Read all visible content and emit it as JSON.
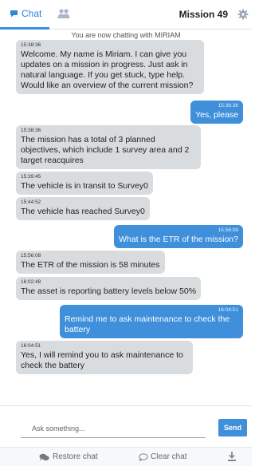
{
  "header": {
    "chat_tab_label": "Chat",
    "chat_icon": "chat-bubble-icon",
    "people_icon": "people-icon",
    "mission_title": "Mission 49",
    "settings_icon": "gear-icon"
  },
  "chat": {
    "notice": "You are now chatting with MIRIAM",
    "messages": [
      {
        "dir": "in",
        "time": "15:38:36",
        "text": "Welcome. My name is Miriam. I can give you updates on a mission in progress. Just ask in natural language. If you get stuck, type help. Would like an overview of the current mission?"
      },
      {
        "dir": "out",
        "time": "15:38:36",
        "text": "Yes, please"
      },
      {
        "dir": "in",
        "time": "15:38:36",
        "text": "The mission has a total of 3 planned objectives, which include 1 survey area and 2 target reacquires"
      },
      {
        "dir": "in",
        "time": "15:39:45",
        "text": "The vehicle is in transit to Survey0"
      },
      {
        "dir": "in",
        "time": "15:44:52",
        "text": "The vehicle has reached Survey0"
      },
      {
        "dir": "out",
        "time": "15:56:08",
        "text": "What is the ETR of the mission?"
      },
      {
        "dir": "in",
        "time": "15:56:08",
        "text": "The ETR of the mission is 58 minutes"
      },
      {
        "dir": "in",
        "time": "16:02:48",
        "text": "The asset is reporting battery levels below 50%"
      },
      {
        "dir": "out",
        "time": "16:04:51",
        "text": "Remind me to ask maintenance to check the battery"
      },
      {
        "dir": "in",
        "time": "16:04:51",
        "text": "Yes, I will remind you to ask maintenance to check the battery"
      }
    ]
  },
  "composer": {
    "placeholder": "Ask something...",
    "send_label": "Send"
  },
  "footer": {
    "restore_label": "Restore chat",
    "restore_icon": "chat-bubbles-icon",
    "clear_label": "Clear chat",
    "clear_icon": "empty-bubble-icon",
    "download_icon": "download-icon"
  },
  "colors": {
    "accent": "#3f8fdb",
    "incoming_bubble": "#d9dcdf"
  }
}
